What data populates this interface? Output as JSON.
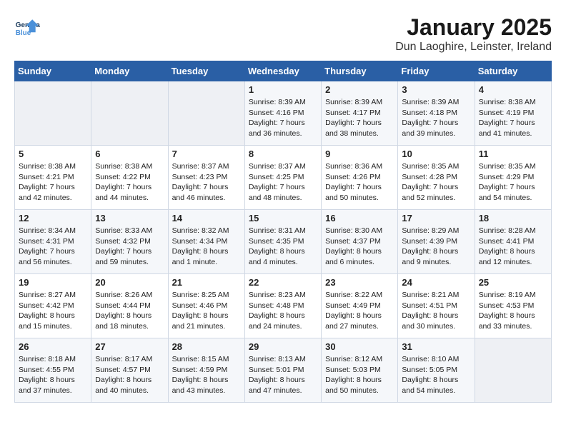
{
  "header": {
    "logo_line1": "General",
    "logo_line2": "Blue",
    "title": "January 2025",
    "subtitle": "Dun Laoghire, Leinster, Ireland"
  },
  "weekdays": [
    "Sunday",
    "Monday",
    "Tuesday",
    "Wednesday",
    "Thursday",
    "Friday",
    "Saturday"
  ],
  "weeks": [
    [
      {
        "day": "",
        "sunrise": "",
        "sunset": "",
        "daylight": ""
      },
      {
        "day": "",
        "sunrise": "",
        "sunset": "",
        "daylight": ""
      },
      {
        "day": "",
        "sunrise": "",
        "sunset": "",
        "daylight": ""
      },
      {
        "day": "1",
        "sunrise": "8:39 AM",
        "sunset": "4:16 PM",
        "daylight": "7 hours and 36 minutes."
      },
      {
        "day": "2",
        "sunrise": "8:39 AM",
        "sunset": "4:17 PM",
        "daylight": "7 hours and 38 minutes."
      },
      {
        "day": "3",
        "sunrise": "8:39 AM",
        "sunset": "4:18 PM",
        "daylight": "7 hours and 39 minutes."
      },
      {
        "day": "4",
        "sunrise": "8:38 AM",
        "sunset": "4:19 PM",
        "daylight": "7 hours and 41 minutes."
      }
    ],
    [
      {
        "day": "5",
        "sunrise": "8:38 AM",
        "sunset": "4:21 PM",
        "daylight": "7 hours and 42 minutes."
      },
      {
        "day": "6",
        "sunrise": "8:38 AM",
        "sunset": "4:22 PM",
        "daylight": "7 hours and 44 minutes."
      },
      {
        "day": "7",
        "sunrise": "8:37 AM",
        "sunset": "4:23 PM",
        "daylight": "7 hours and 46 minutes."
      },
      {
        "day": "8",
        "sunrise": "8:37 AM",
        "sunset": "4:25 PM",
        "daylight": "7 hours and 48 minutes."
      },
      {
        "day": "9",
        "sunrise": "8:36 AM",
        "sunset": "4:26 PM",
        "daylight": "7 hours and 50 minutes."
      },
      {
        "day": "10",
        "sunrise": "8:35 AM",
        "sunset": "4:28 PM",
        "daylight": "7 hours and 52 minutes."
      },
      {
        "day": "11",
        "sunrise": "8:35 AM",
        "sunset": "4:29 PM",
        "daylight": "7 hours and 54 minutes."
      }
    ],
    [
      {
        "day": "12",
        "sunrise": "8:34 AM",
        "sunset": "4:31 PM",
        "daylight": "7 hours and 56 minutes."
      },
      {
        "day": "13",
        "sunrise": "8:33 AM",
        "sunset": "4:32 PM",
        "daylight": "7 hours and 59 minutes."
      },
      {
        "day": "14",
        "sunrise": "8:32 AM",
        "sunset": "4:34 PM",
        "daylight": "8 hours and 1 minute."
      },
      {
        "day": "15",
        "sunrise": "8:31 AM",
        "sunset": "4:35 PM",
        "daylight": "8 hours and 4 minutes."
      },
      {
        "day": "16",
        "sunrise": "8:30 AM",
        "sunset": "4:37 PM",
        "daylight": "8 hours and 6 minutes."
      },
      {
        "day": "17",
        "sunrise": "8:29 AM",
        "sunset": "4:39 PM",
        "daylight": "8 hours and 9 minutes."
      },
      {
        "day": "18",
        "sunrise": "8:28 AM",
        "sunset": "4:41 PM",
        "daylight": "8 hours and 12 minutes."
      }
    ],
    [
      {
        "day": "19",
        "sunrise": "8:27 AM",
        "sunset": "4:42 PM",
        "daylight": "8 hours and 15 minutes."
      },
      {
        "day": "20",
        "sunrise": "8:26 AM",
        "sunset": "4:44 PM",
        "daylight": "8 hours and 18 minutes."
      },
      {
        "day": "21",
        "sunrise": "8:25 AM",
        "sunset": "4:46 PM",
        "daylight": "8 hours and 21 minutes."
      },
      {
        "day": "22",
        "sunrise": "8:23 AM",
        "sunset": "4:48 PM",
        "daylight": "8 hours and 24 minutes."
      },
      {
        "day": "23",
        "sunrise": "8:22 AM",
        "sunset": "4:49 PM",
        "daylight": "8 hours and 27 minutes."
      },
      {
        "day": "24",
        "sunrise": "8:21 AM",
        "sunset": "4:51 PM",
        "daylight": "8 hours and 30 minutes."
      },
      {
        "day": "25",
        "sunrise": "8:19 AM",
        "sunset": "4:53 PM",
        "daylight": "8 hours and 33 minutes."
      }
    ],
    [
      {
        "day": "26",
        "sunrise": "8:18 AM",
        "sunset": "4:55 PM",
        "daylight": "8 hours and 37 minutes."
      },
      {
        "day": "27",
        "sunrise": "8:17 AM",
        "sunset": "4:57 PM",
        "daylight": "8 hours and 40 minutes."
      },
      {
        "day": "28",
        "sunrise": "8:15 AM",
        "sunset": "4:59 PM",
        "daylight": "8 hours and 43 minutes."
      },
      {
        "day": "29",
        "sunrise": "8:13 AM",
        "sunset": "5:01 PM",
        "daylight": "8 hours and 47 minutes."
      },
      {
        "day": "30",
        "sunrise": "8:12 AM",
        "sunset": "5:03 PM",
        "daylight": "8 hours and 50 minutes."
      },
      {
        "day": "31",
        "sunrise": "8:10 AM",
        "sunset": "5:05 PM",
        "daylight": "8 hours and 54 minutes."
      },
      {
        "day": "",
        "sunrise": "",
        "sunset": "",
        "daylight": ""
      }
    ]
  ]
}
